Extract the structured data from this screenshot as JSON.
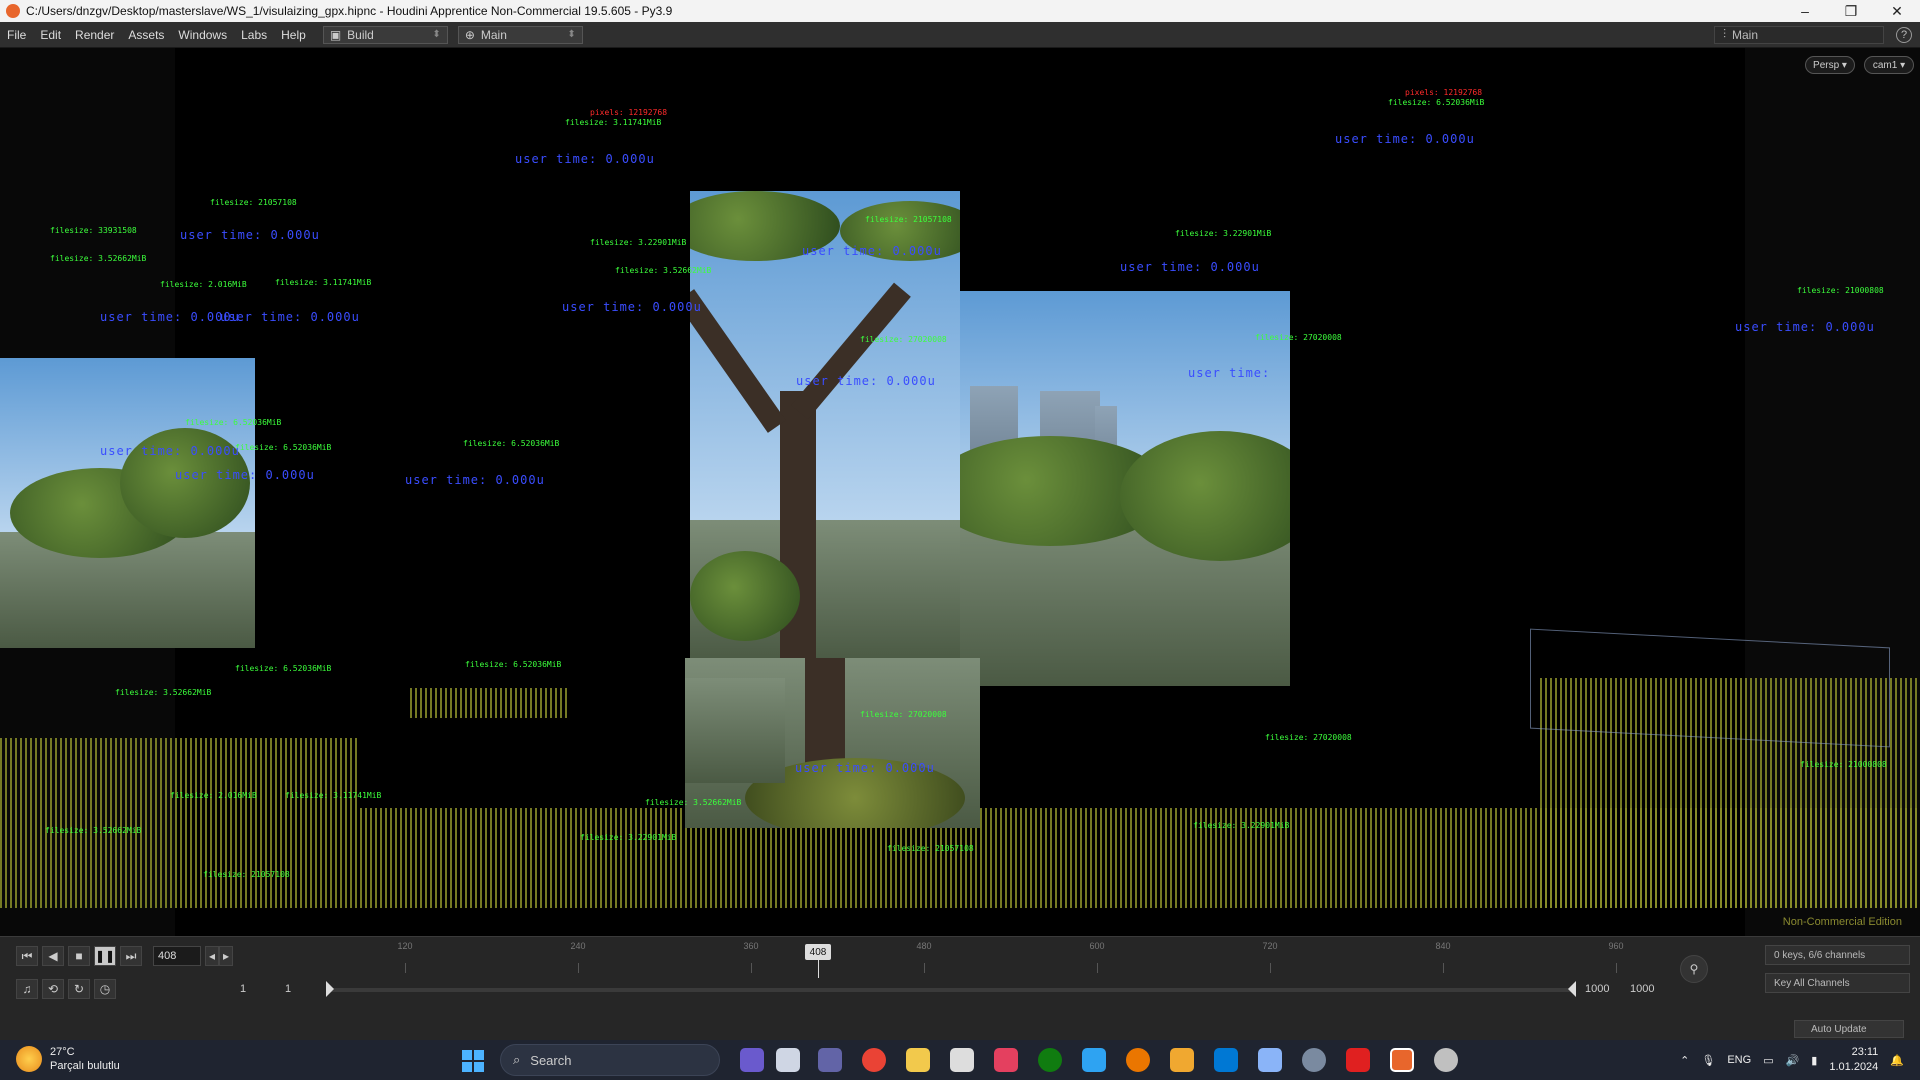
{
  "window": {
    "title": "C:/Users/dnzgv/Desktop/masterslave/WS_1/visulaizing_gpx.hipnc - Houdini Apprentice Non-Commercial 19.5.605 - Py3.9",
    "minimize": "–",
    "maximize": "❐",
    "close": "✕"
  },
  "menu": {
    "items": [
      "File",
      "Edit",
      "Render",
      "Assets",
      "Windows",
      "Labs",
      "Help"
    ],
    "desktop": "Build",
    "main_selector": "Main",
    "right_selector": "Main",
    "help": "?"
  },
  "viewport": {
    "persp": "Persp ▾",
    "cam": "cam1 ▾",
    "watermark": "Non-Commercial Edition",
    "labels": {
      "user_time": "user time: 0.000u",
      "user_time_short": "user time:",
      "fs1": "filesize: 21057108",
      "fs2": "filesize: 3.22901MiB",
      "fs3": "filesize: 6.52036MiB",
      "fs4": "filesize: 3.11741MiB",
      "fs5": "filesize: 2.016MiB",
      "fs6": "filesize: 33931508",
      "fs7": "filesize: 27020008",
      "fs8": "filesize: 3.52662MiB",
      "fs9": "filesize: 21000808",
      "px1": "pixels: 12192768",
      "px2": "pixels: 12192768"
    }
  },
  "timeline": {
    "current_frame": "408",
    "playhead": "408",
    "ticks": [
      "120",
      "240",
      "360",
      "480",
      "600",
      "720",
      "840",
      "960"
    ],
    "start_a": "1",
    "start_b": "1",
    "end_a": "1000",
    "end_b": "1000",
    "keys_info": "0 keys, 6/6 channels",
    "key_all": "Key All Channels",
    "auto_update": "Auto Update"
  },
  "taskbar": {
    "temp": "27°C",
    "weather": "Parçalı bulutlu",
    "search": "Search",
    "lang": "ENG",
    "time": "23:11",
    "date": "1.01.2024"
  },
  "colors": {
    "label_red": "#ff2b2b",
    "label_green": "#3cff3c",
    "label_blue": "#3a4dff",
    "houdini_orange": "#e8662c"
  }
}
